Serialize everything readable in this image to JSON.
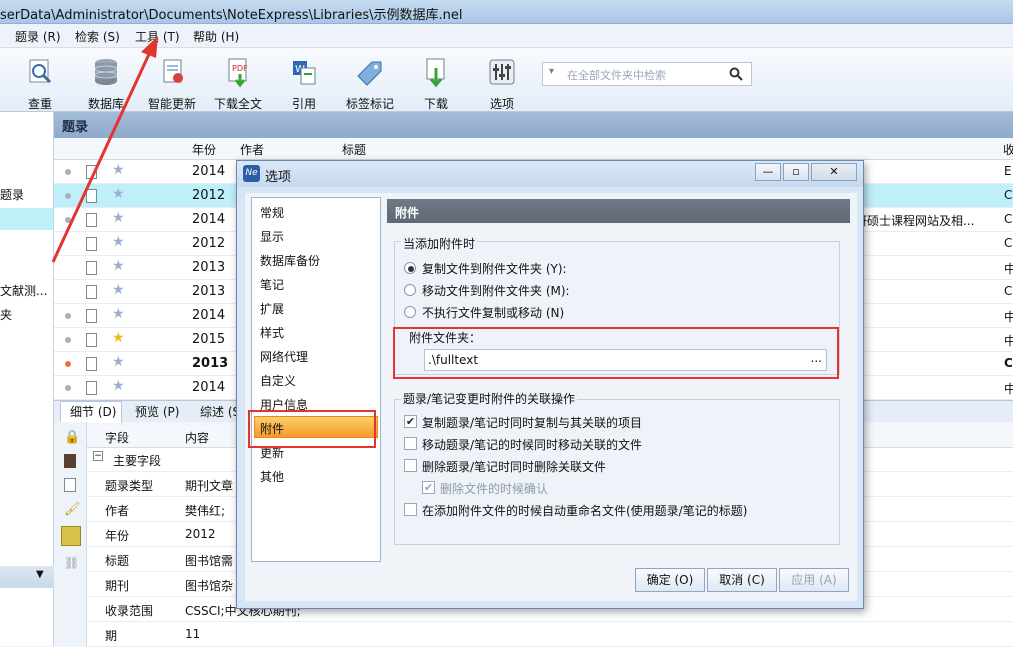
{
  "window": {
    "title": "serData\\Administrator\\Documents\\NoteExpress\\Libraries\\示例数据库.nel"
  },
  "menu": [
    {
      "label": "题录 (R)"
    },
    {
      "label": "检索 (S)"
    },
    {
      "label": "工具 (T)"
    },
    {
      "label": "帮助 (H)"
    }
  ],
  "toolbar": {
    "items": [
      {
        "label": "查重",
        "icon": "magnifier-doc-icon"
      },
      {
        "label": "数据库",
        "icon": "database-icon"
      },
      {
        "label": "智能更新",
        "icon": "smart-update-icon"
      },
      {
        "label": "下载全文",
        "icon": "pdf-download-icon"
      },
      {
        "label": "引用",
        "icon": "word-cite-icon"
      },
      {
        "label": "标签标记",
        "icon": "tag-icon"
      },
      {
        "label": "下载",
        "icon": "download-icon"
      },
      {
        "label": "选项",
        "icon": "options-sliders-icon"
      }
    ],
    "search_placeholder": "在全部文件夹中检索"
  },
  "left_pane": {
    "items": [
      "题录",
      "文献测...",
      "夹"
    ]
  },
  "list": {
    "header_title": "题录",
    "columns": [
      "年份",
      "作者",
      "标题",
      "收"
    ],
    "rows": [
      {
        "year": "2014",
        "col": "E",
        "selected": false,
        "dot": "gray",
        "starred": false
      },
      {
        "year": "2012",
        "col": "C",
        "selected": true,
        "dot": "gray",
        "starred": false
      },
      {
        "year": "2014",
        "col": "C",
        "selected": false,
        "dot": "gray",
        "starred": false
      },
      {
        "year": "2012",
        "col": "C",
        "selected": false,
        "dot": "none",
        "starred": false
      },
      {
        "year": "2013",
        "col": "中",
        "selected": false,
        "dot": "none",
        "starred": false
      },
      {
        "year": "2013",
        "col": "C",
        "selected": false,
        "dot": "none",
        "starred": false
      },
      {
        "year": "2014",
        "col": "中",
        "selected": false,
        "dot": "gray",
        "starred": false
      },
      {
        "year": "2015",
        "col": "中",
        "selected": false,
        "dot": "gray",
        "starred": true
      },
      {
        "year": "2013",
        "col": "C",
        "selected": false,
        "dot": "orange",
        "starred": false,
        "bold": true
      },
      {
        "year": "2014",
        "col": "中",
        "selected": false,
        "dot": "gray",
        "starred": false
      }
    ],
    "partial_title_right": "研硕士课程网站及相..."
  },
  "detail": {
    "tabs": [
      "细节 (D)",
      "预览 (P)",
      "综述 (S"
    ],
    "columns": [
      "字段",
      "内容"
    ],
    "group_label": "主要字段",
    "fields": [
      {
        "k": "题录类型",
        "v": "期刊文章"
      },
      {
        "k": "作者",
        "v": "樊伟红; "
      },
      {
        "k": "年份",
        "v": "2012"
      },
      {
        "k": "标题",
        "v": "图书馆需"
      },
      {
        "k": "期刊",
        "v": "图书馆杂"
      },
      {
        "k": "收录范围",
        "v": "CSSCI;中文核心期刊;"
      },
      {
        "k": "期",
        "v": "11"
      }
    ]
  },
  "dialog": {
    "title": "选项",
    "logo_text": "Ne",
    "nav": [
      "常规",
      "显示",
      "数据库备份",
      "笔记",
      "扩展",
      "样式",
      "网络代理",
      "自定义",
      "用户信息",
      "附件",
      "更新",
      "其他"
    ],
    "selected_nav": "附件",
    "panel_title": "附件",
    "group1_title": "当添加附件时",
    "radio_options": [
      {
        "label": "复制文件到附件文件夹 (Y):",
        "checked": true,
        "disabled": false
      },
      {
        "label": "移动文件到附件文件夹 (M):",
        "checked": false,
        "disabled": false
      },
      {
        "label": "不执行文件复制或移动 (N)",
        "checked": false,
        "disabled": false
      }
    ],
    "folder_label": "附件文件夹：",
    "folder_value": ".\\fulltext",
    "folder_browse": "...",
    "group2_title": "题录/笔记变更时附件的关联操作",
    "check_options": [
      {
        "label": "复制题录/笔记时同时复制与其关联的项目",
        "checked": true,
        "disabled": false
      },
      {
        "label": "移动题录/笔记的时候同时移动关联的文件",
        "checked": false,
        "disabled": false
      },
      {
        "label": "删除题录/笔记时同时删除关联文件",
        "checked": false,
        "disabled": false
      },
      {
        "label": "删除文件的时候确认",
        "checked": true,
        "disabled": true
      },
      {
        "label": "在添加附件文件的时候自动重命名文件(使用题录/笔记的标题)",
        "checked": false,
        "disabled": false
      }
    ],
    "buttons": {
      "ok": "确定 (O)",
      "cancel": "取消 (C)",
      "apply": "应用 (A)"
    }
  }
}
